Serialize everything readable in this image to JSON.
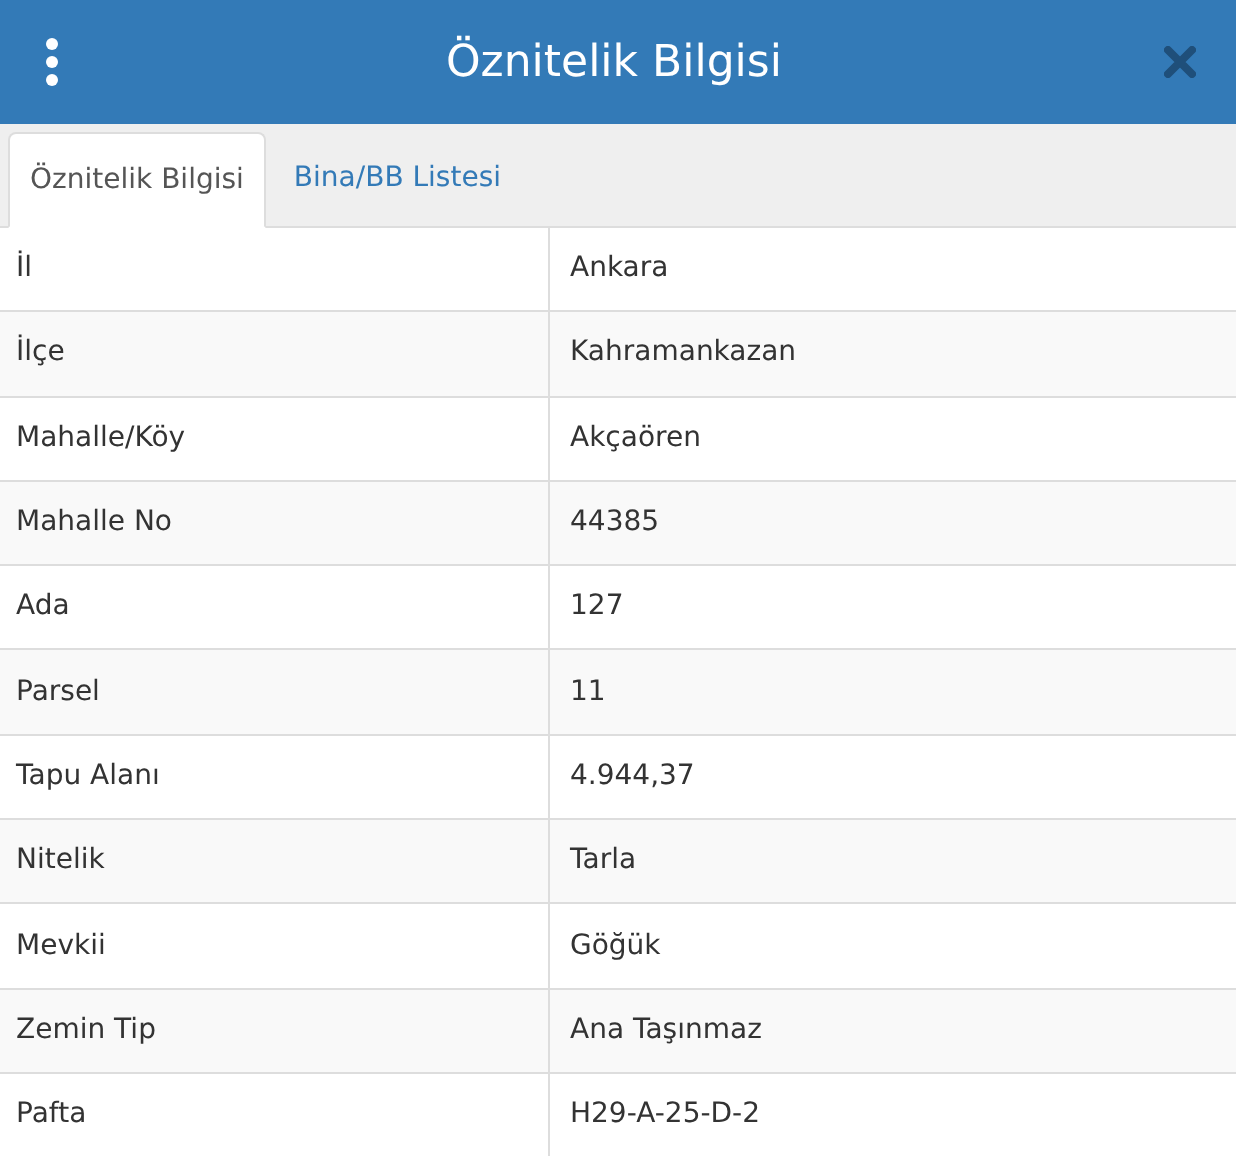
{
  "window": {
    "title": "Öznitelik Bilgisi"
  },
  "tabs": [
    {
      "label": "Öznitelik Bilgisi",
      "selected": true
    },
    {
      "label": "Bina/BB Listesi",
      "selected": false
    }
  ],
  "table": {
    "rows": [
      {
        "label": "İl",
        "value": "Ankara"
      },
      {
        "label": "İlçe",
        "value": "Kahramankazan"
      },
      {
        "label": "Mahalle/Köy",
        "value": "Akçaören"
      },
      {
        "label": "Mahalle No",
        "value": "44385"
      },
      {
        "label": "Ada",
        "value": "127"
      },
      {
        "label": "Parsel",
        "value": "11"
      },
      {
        "label": "Tapu Alanı",
        "value": "4.944,37"
      },
      {
        "label": "Nitelik",
        "value": "Tarla"
      },
      {
        "label": "Mevkii",
        "value": "Göğük"
      },
      {
        "label": "Zemin Tip",
        "value": "Ana Taşınmaz"
      },
      {
        "label": "Pafta",
        "value": "H29-A-25-D-2"
      }
    ]
  }
}
